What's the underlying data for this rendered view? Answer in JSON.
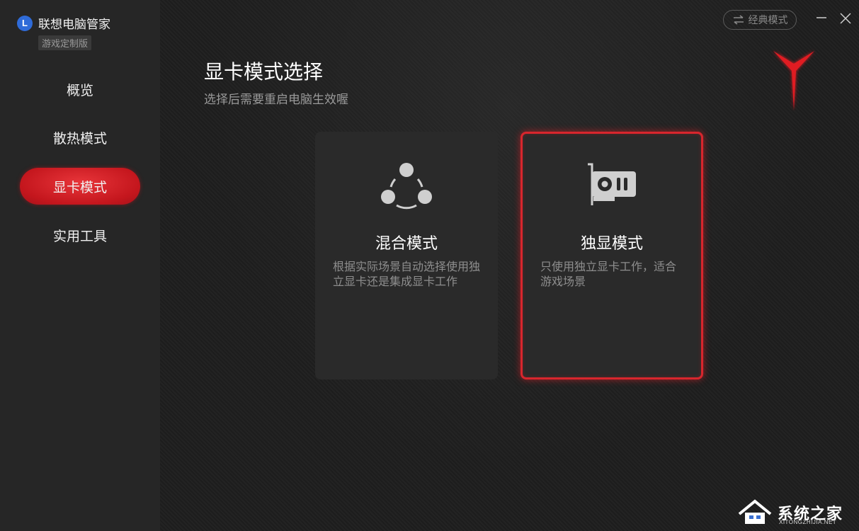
{
  "app": {
    "logo_letter": "L",
    "title": "联想电脑管家",
    "edition": "游戏定制版"
  },
  "sidebar": {
    "items": [
      {
        "label": "概览",
        "active": false
      },
      {
        "label": "散热模式",
        "active": false
      },
      {
        "label": "显卡模式",
        "active": true
      },
      {
        "label": "实用工具",
        "active": false
      }
    ]
  },
  "header": {
    "classic_mode_label": "经典模式",
    "minimize_icon": "minimize-icon",
    "close_icon": "close-icon"
  },
  "page": {
    "title": "显卡模式选择",
    "subtitle": "选择后需要重启电脑生效喔"
  },
  "modes": [
    {
      "title": "混合模式",
      "description": "根据实际场景自动选择使用独立显卡还是集成显卡工作",
      "icon": "hybrid-nodes-icon",
      "selected": false
    },
    {
      "title": "独显模式",
      "description": "只使用独立显卡工作，适合游戏场景",
      "icon": "graphics-card-icon",
      "selected": true
    }
  ],
  "watermark": {
    "text": "系统之家",
    "url": "XITONGZHIJIA.NET"
  },
  "colors": {
    "accent_red": "#d8262d",
    "sidebar_bg": "#262626",
    "logo_blue": "#2f6bd8"
  }
}
